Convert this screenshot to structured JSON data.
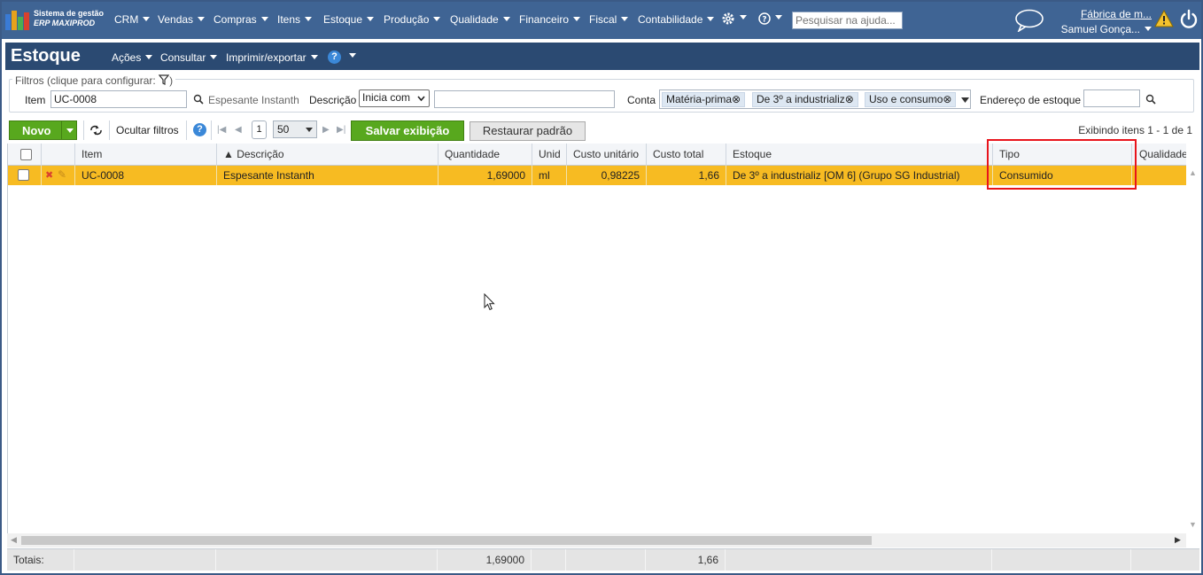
{
  "nav": {
    "brand_line1": "Sistema de gestão",
    "brand_line2": "ERP MAXIPROD",
    "menu": [
      "CRM",
      "Vendas",
      "Compras",
      "Itens",
      "Estoque",
      "Produção",
      "Qualidade",
      "Financeiro",
      "Fiscal",
      "Contabilidade"
    ],
    "help_search_placeholder": "Pesquisar na ajuda...",
    "company": "Fábrica de m...",
    "user": "Samuel Gonça...",
    "icons": [
      "gear-icon",
      "help-icon",
      "chat-icon",
      "warning-icon",
      "power-icon"
    ]
  },
  "titlebar": {
    "title": "Estoque",
    "menu": [
      "Ações",
      "Consultar",
      "Imprimir/exportar"
    ]
  },
  "filters": {
    "legend": "Filtros (clique para configurar:",
    "legend_close": ")",
    "item_label": "Item",
    "item_value": "UC-0008",
    "item_desc": "Espesante Instanth",
    "descricao_label": "Descrição",
    "descricao_mode": "Inicia com",
    "descricao_value": "",
    "conta_label": "Conta",
    "conta_tags": [
      "Matéria-prima",
      "De 3º a industrializ",
      "Uso e consumo"
    ],
    "endereco_label": "Endereço de estoque",
    "endereco_value": ""
  },
  "toolbar": {
    "novo": "Novo",
    "ocultar": "Ocultar filtros",
    "page": "1",
    "page_size": "50",
    "salvar": "Salvar exibição",
    "restaurar": "Restaurar padrão",
    "count": "Exibindo itens 1 - 1 de 1"
  },
  "grid": {
    "columns": [
      "Item",
      "▲ Descrição",
      "Quantidade",
      "Unid",
      "Custo unitário",
      "Custo total",
      "Estoque",
      "Tipo",
      "Qualidade"
    ],
    "rows": [
      {
        "item": "UC-0008",
        "descricao": "Espesante Instanth",
        "quantidade": "1,69000",
        "unid": "ml",
        "custo_unitario": "0,98225",
        "custo_total": "1,66",
        "estoque": "De 3º a industrializ [OM 6] (Grupo SG Industrial)",
        "tipo": "Consumido",
        "qualidade": ""
      }
    ]
  },
  "totals": {
    "label": "Totais:",
    "quantidade": "1,69000",
    "custo_total": "1,66"
  },
  "colors": {
    "nav_bg": "#3f6494",
    "title_bg": "#2b4a72",
    "selected_row": "#f7bb22",
    "button_green": "#58a81e",
    "highlight_box": "#e8141c"
  }
}
